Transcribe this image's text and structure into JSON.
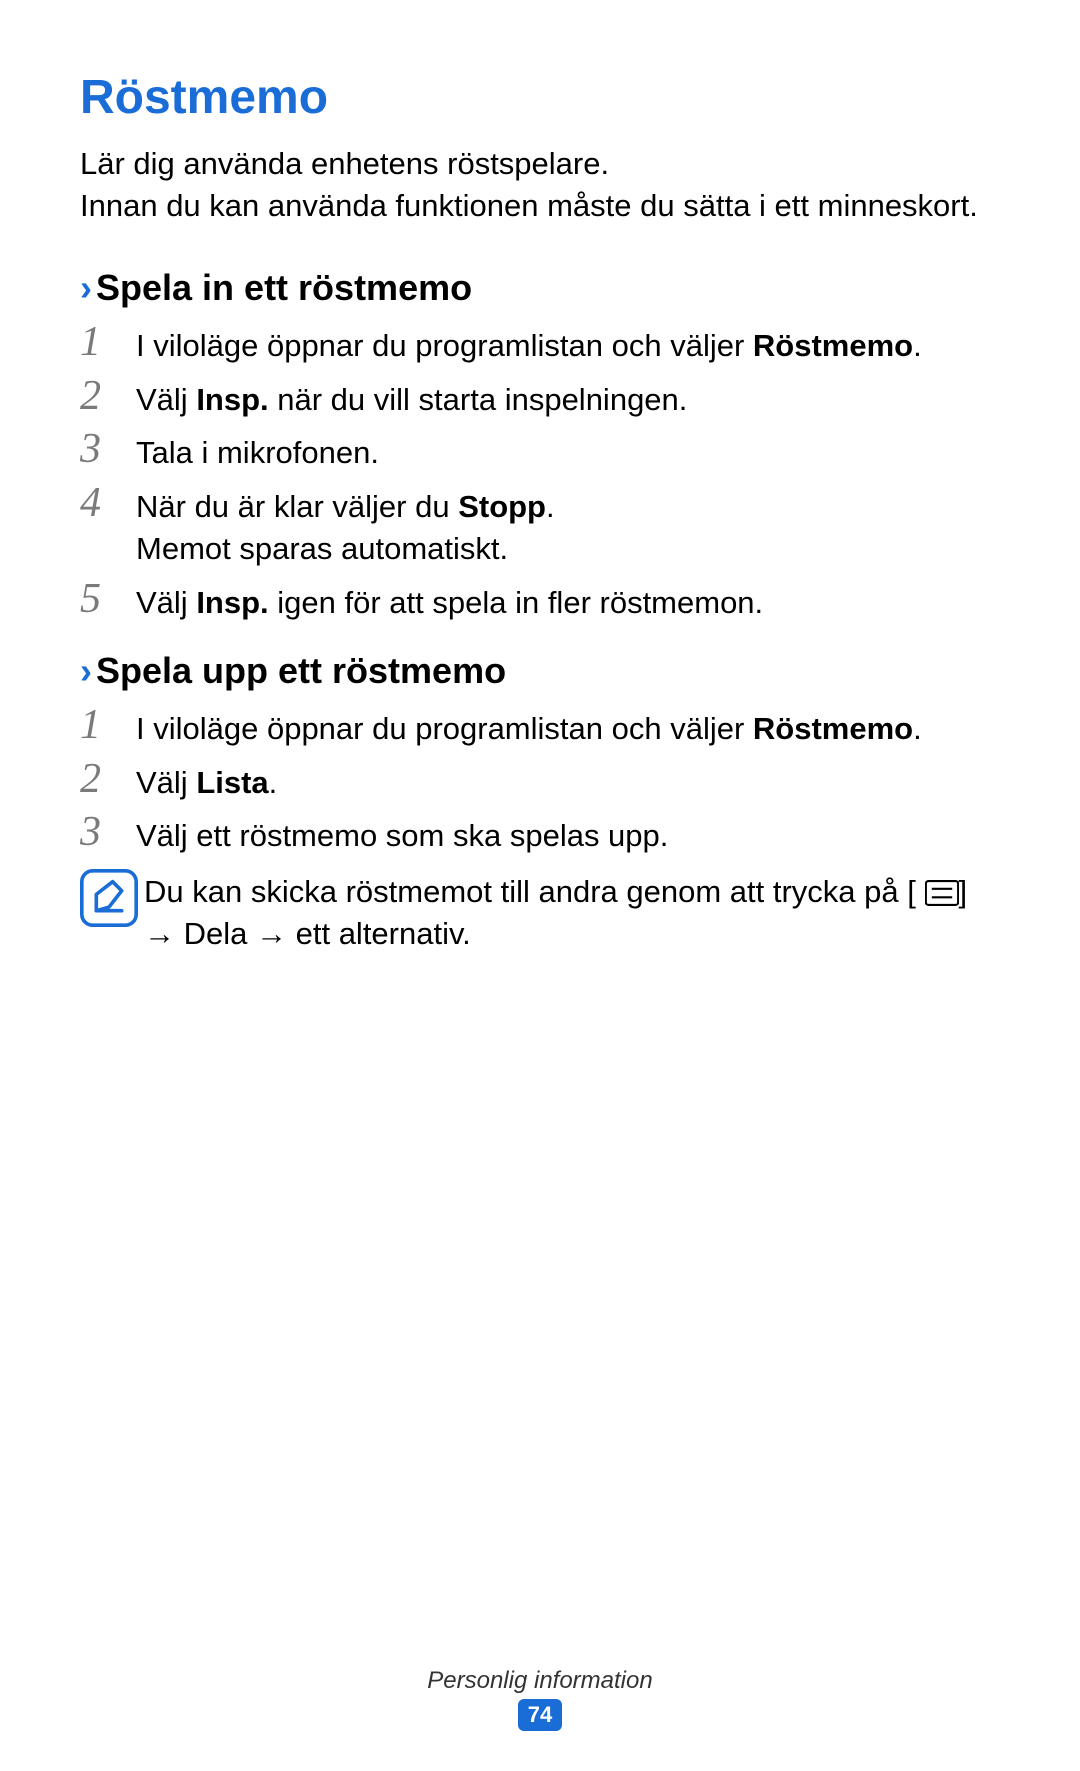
{
  "title": "Röstmemo",
  "lead": "Lär dig använda enhetens röstspelare.\nInnan du kan använda funktionen måste du sätta i ett minneskort.",
  "sections": [
    {
      "heading": "Spela in ett röstmemo",
      "steps": [
        {
          "n": "1",
          "text_before": "I viloläge öppnar du programlistan och väljer ",
          "bold": "Röstmemo",
          "text_after": "."
        },
        {
          "n": "2",
          "text_before": "Välj ",
          "bold": "Insp.",
          "text_after": " när du vill starta inspelningen."
        },
        {
          "n": "3",
          "text_before": "Tala i mikrofonen.",
          "bold": "",
          "text_after": ""
        },
        {
          "n": "4",
          "text_before": "När du är klar väljer du ",
          "bold": "Stopp",
          "text_after": ".\nMemot sparas automatiskt."
        },
        {
          "n": "5",
          "text_before": "Välj ",
          "bold": "Insp.",
          "text_after": " igen för att spela in fler röstmemon."
        }
      ]
    },
    {
      "heading": "Spela upp ett röstmemo",
      "steps": [
        {
          "n": "1",
          "text_before": "I viloläge öppnar du programlistan och väljer ",
          "bold": "Röstmemo",
          "text_after": "."
        },
        {
          "n": "2",
          "text_before": "Välj ",
          "bold": "Lista",
          "text_after": "."
        },
        {
          "n": "3",
          "text_before": "Välj ett röstmemo som ska spelas upp.",
          "bold": "",
          "text_after": ""
        }
      ],
      "note": {
        "text_before": "Du kan skicka röstmemot till andra genom att trycka på [",
        "text_mid": "] → ",
        "bold": "Dela",
        "text_after": " → ett alternativ."
      }
    }
  ],
  "footer": {
    "label": "Personlig information",
    "page": "74"
  },
  "chevron": "›"
}
